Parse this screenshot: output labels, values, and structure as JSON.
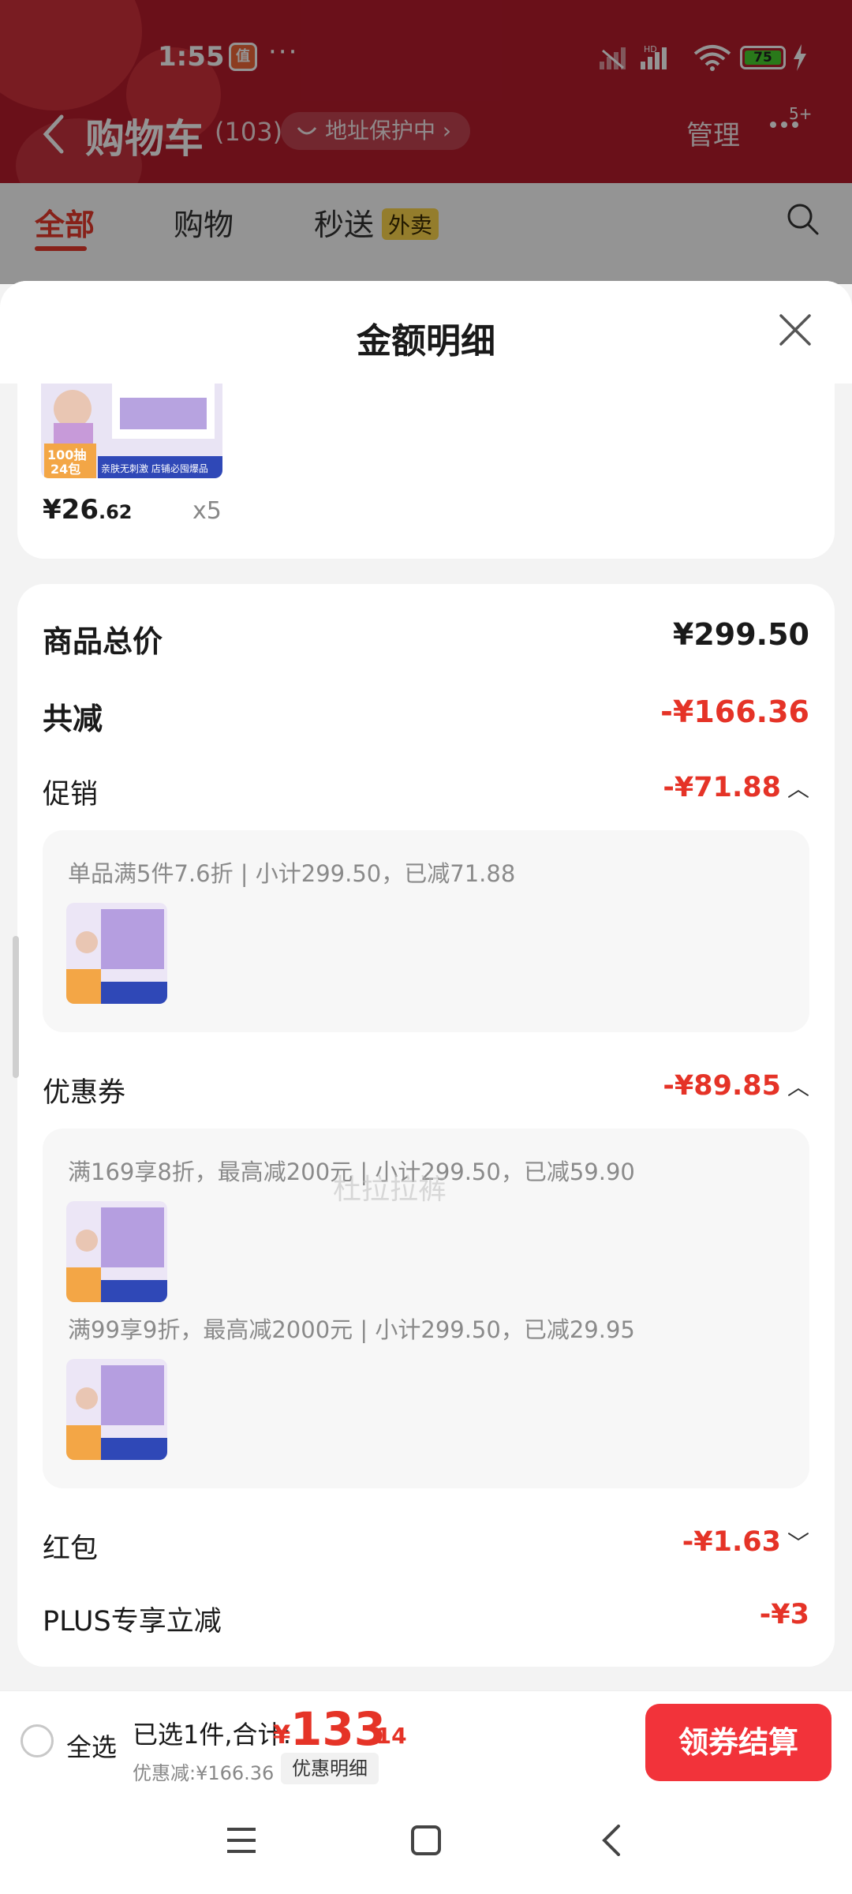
{
  "status_bar": {
    "time": "1:55",
    "app_badge": "值",
    "dots": "···",
    "battery": "75",
    "signal_icon": "signal-icon",
    "wifi_icon": "wifi-icon"
  },
  "header": {
    "title": "购物车",
    "count": "(103)",
    "address_protect": "地址保护中 ›",
    "manage": "管理",
    "message_badge": "5+"
  },
  "tabs": [
    {
      "label": "全部",
      "active": true
    },
    {
      "label": "购物",
      "active": false
    },
    {
      "label": "秒送",
      "active": false,
      "tag": "外卖"
    }
  ],
  "sheet": {
    "title": "金额明细",
    "product": {
      "price_int": "¥26",
      "price_dec": ".62",
      "qty": "x5",
      "image_text_top": "100抽",
      "image_text_bottom": "24包",
      "image_banner": "亲肤无刺激 店铺必囤爆品"
    },
    "summary": {
      "total_label": "商品总价",
      "total_value": "¥299.50",
      "reduce_label": "共减",
      "reduce_value": "-¥166.36"
    },
    "promotion": {
      "label": "促销",
      "value": "-¥71.88",
      "detail": "单品满5件7.6折 | 小计299.50，已减71.88"
    },
    "coupon": {
      "label": "优惠券",
      "value": "-¥89.85",
      "details": [
        "满169享8折，最高减200元 | 小计299.50，已减59.90",
        "满99享9折，最高减2000元 | 小计299.50，已减29.95"
      ]
    },
    "red_packet": {
      "label": "红包",
      "value": "-¥1.63"
    },
    "plus": {
      "label": "PLUS专享立减",
      "value": "-¥3"
    },
    "watermark": "杜拉拉裤"
  },
  "bottom_bar": {
    "select_all": "全选",
    "selected": "已选1件,合计:",
    "total_yen": "¥",
    "total_int": "133",
    "total_dec": ".14",
    "discount": "优惠减:¥166.36",
    "detail_button": "优惠明细",
    "checkout": "领券结算"
  },
  "colors": {
    "header_red": "#b71c2c",
    "accent_red": "#e53327",
    "checkout_red": "#f2333a"
  }
}
